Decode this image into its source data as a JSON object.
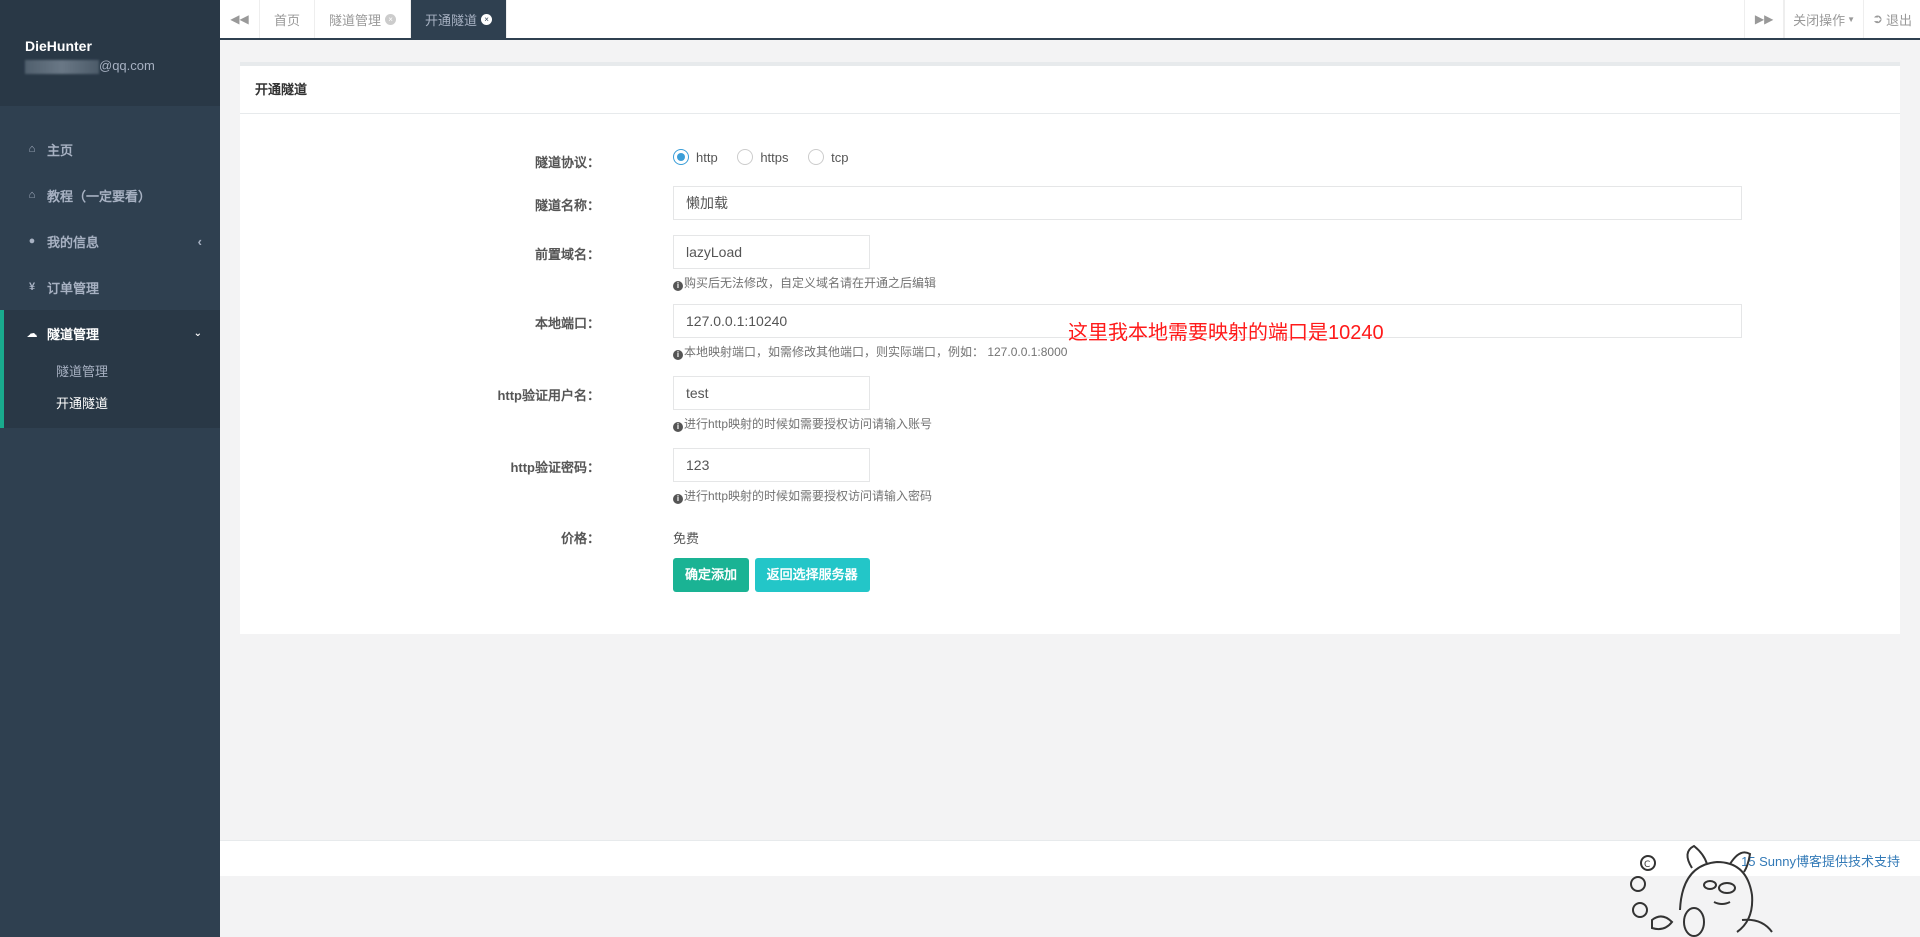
{
  "user": {
    "name": "DieHunter",
    "email_suffix": "@qq.com"
  },
  "sidebar": {
    "items": [
      {
        "label": "主页",
        "icon": "home-icon"
      },
      {
        "label": "教程（一定要看）",
        "icon": "home-icon"
      },
      {
        "label": "我的信息",
        "icon": "user-icon"
      },
      {
        "label": "订单管理",
        "icon": "yen-icon"
      },
      {
        "label": "隧道管理",
        "icon": "cloud-icon"
      }
    ],
    "sub_items": [
      "隧道管理",
      "开通隧道"
    ]
  },
  "tabs": [
    {
      "label": "首页"
    },
    {
      "label": "隧道管理"
    },
    {
      "label": "开通隧道"
    }
  ],
  "topbar": {
    "close_ops": "关闭操作",
    "logout": "退出"
  },
  "panel": {
    "title": "开通隧道"
  },
  "form": {
    "protocol_label": "隧道协议：",
    "protocols": [
      "http",
      "https",
      "tcp"
    ],
    "protocol_selected": "http",
    "name_label": "隧道名称：",
    "name_value": "懒加载",
    "domain_label": "前置域名：",
    "domain_value": "lazyLoad",
    "domain_help": "购买后无法修改，自定义域名请在开通之后编辑",
    "port_label": "本地端口：",
    "port_value": "127.0.0.1:10240",
    "port_help": "本地映射端口，如需修改其他端口，则实际端口，例如： 127.0.0.1:8000",
    "port_note": "这里我本地需要映射的端口是10240",
    "user_label": "http验证用户名：",
    "user_value": "test",
    "user_help": "进行http映射的时候如需要授权访问请输入账号",
    "pwd_label": "http验证密码：",
    "pwd_value": "123",
    "pwd_help": "进行http映射的时候如需要授权访问请输入密码",
    "price_label": "价格：",
    "price_value": "免费",
    "submit": "确定添加",
    "back": "返回选择服务器"
  },
  "footer": {
    "copyright": "15 Sunny博客提供技术支持"
  }
}
